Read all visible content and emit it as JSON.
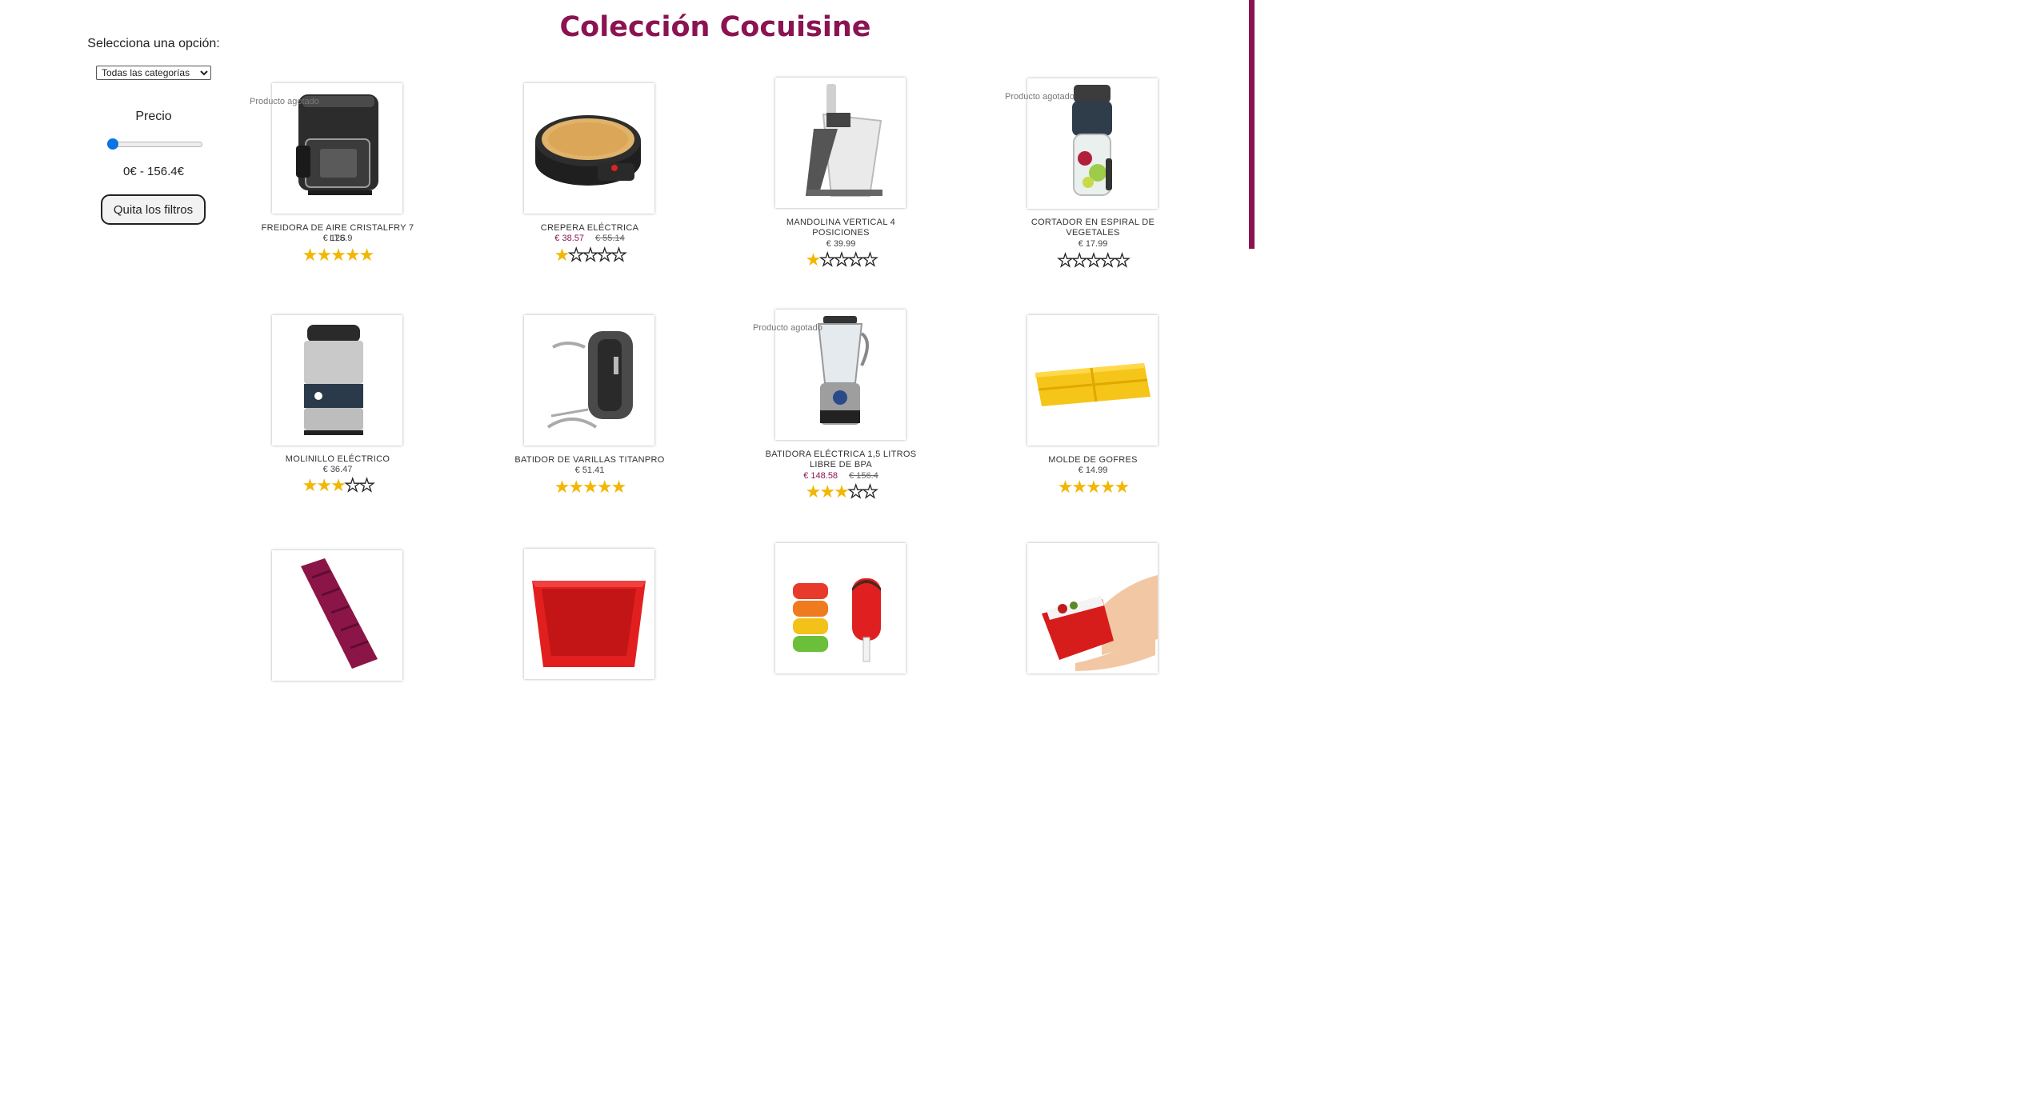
{
  "page": {
    "title": "Colección Cocuisine",
    "accent_color": "#8b1352"
  },
  "filters": {
    "select_label": "Selecciona una opción:",
    "category_selected": "Todas las categorías",
    "price_label": "Precio",
    "price_range": "0€ - 156.4€",
    "price_min_fraction": 0,
    "reset_label": "Quita los filtros"
  },
  "sold_out_label": "Producto agotado",
  "products": [
    {
      "name": "FREIDORA DE AIRE CRISTALFRY 7 LTS",
      "price": "€ 126.9",
      "sale_price": "",
      "old_price": "",
      "rating": 5,
      "sold_out": true,
      "icon": "air-fryer-icon"
    },
    {
      "name": "CREPERA ELÉCTRICA",
      "price": "",
      "sale_price": "€ 38.57",
      "old_price": "€ 55.14",
      "rating": 1,
      "sold_out": false,
      "icon": "crepe-maker-icon"
    },
    {
      "name": "MANDOLINA VERTICAL 4 POSICIONES",
      "price": "€ 39.99",
      "sale_price": "",
      "old_price": "",
      "rating": 1,
      "sold_out": false,
      "icon": "mandoline-icon"
    },
    {
      "name": "CORTADOR EN ESPIRAL DE VEGETALES",
      "price": "€ 17.99",
      "sale_price": "",
      "old_price": "",
      "rating": 0,
      "sold_out": true,
      "icon": "spiralizer-icon"
    },
    {
      "name": "MOLINILLO ELÉCTRICO",
      "price": "€ 36.47",
      "sale_price": "",
      "old_price": "",
      "rating": 3,
      "sold_out": false,
      "icon": "grinder-icon"
    },
    {
      "name": "BATIDOR DE VARILLAS TITANPRO",
      "price": "€ 51.41",
      "sale_price": "",
      "old_price": "",
      "rating": 5,
      "sold_out": false,
      "icon": "hand-mixer-icon"
    },
    {
      "name": "BATIDORA ELÉCTRICA 1,5 LITROS LIBRE DE BPA",
      "price": "",
      "sale_price": "€ 148.58",
      "old_price": "€ 156.4",
      "rating": 3,
      "sold_out": true,
      "icon": "blender-icon"
    },
    {
      "name": "MOLDE DE GOFRES",
      "price": "€ 14.99",
      "sale_price": "",
      "old_price": "",
      "rating": 5,
      "sold_out": false,
      "icon": "waffle-mold-icon"
    },
    {
      "name": "",
      "price": "",
      "sale_price": "",
      "old_price": "",
      "rating": 0,
      "sold_out": false,
      "icon": "finger-mold-icon"
    },
    {
      "name": "",
      "price": "",
      "sale_price": "",
      "old_price": "",
      "rating": 0,
      "sold_out": false,
      "icon": "loaf-pan-icon"
    },
    {
      "name": "",
      "price": "",
      "sale_price": "",
      "old_price": "",
      "rating": 0,
      "sold_out": false,
      "icon": "popsicle-mold-icon"
    },
    {
      "name": "",
      "price": "",
      "sale_price": "",
      "old_price": "",
      "rating": 0,
      "sold_out": false,
      "icon": "steam-case-icon"
    }
  ]
}
